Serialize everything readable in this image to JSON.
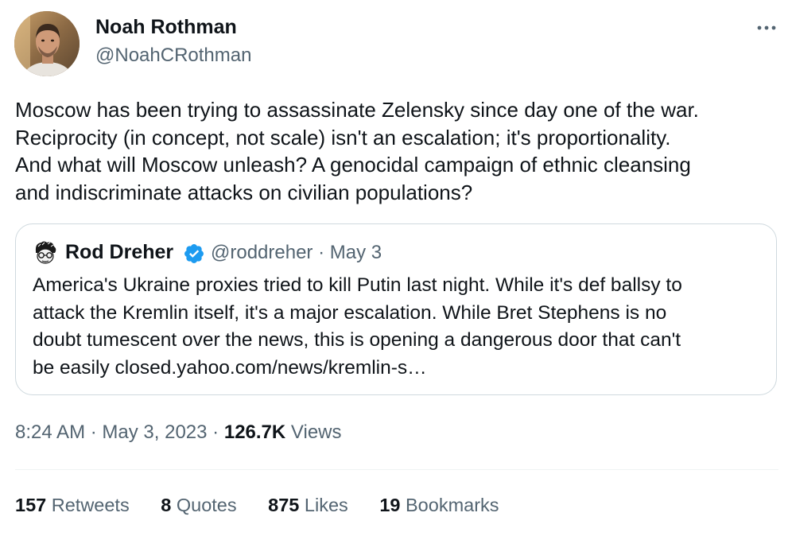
{
  "author": {
    "name": "Noah Rothman",
    "handle": "@NoahCRothman"
  },
  "tweet": {
    "text_lines": [
      "Moscow has been trying to assassinate Zelensky since day one of the war.",
      "Reciprocity (in concept, not scale) isn't an escalation; it's proportionality.",
      "And what will Moscow unleash? A genocidal campaign of ethnic cleansing",
      "and indiscriminate attacks on civilian populations?"
    ]
  },
  "quote": {
    "name": "Rod Dreher",
    "handle": "@roddreher",
    "separator": "·",
    "date": "May 3",
    "verified_icon": "verified-badge-icon",
    "text_lines": [
      "America's Ukraine proxies tried to kill Putin last night. While it's def ballsy to",
      "attack the Kremlin itself, it's a major escalation. While Bret Stephens is no",
      "doubt tumescent over the news, this is opening a dangerous door that can't",
      "be easily closed.yahoo.com/news/kremlin-s…"
    ]
  },
  "meta": {
    "time": "8:24 AM",
    "separator": "·",
    "date": "May 3, 2023",
    "views_count": "126.7K",
    "views_label": "Views"
  },
  "stats": {
    "retweets_count": "157",
    "retweets_label": "Retweets",
    "quotes_count": "8",
    "quotes_label": "Quotes",
    "likes_count": "875",
    "likes_label": "Likes",
    "bookmarks_count": "19",
    "bookmarks_label": "Bookmarks"
  },
  "icons": {
    "more": "more-options-icon"
  },
  "colors": {
    "primary_text": "#0f1419",
    "secondary_text": "#536471",
    "border": "#cfd9de",
    "verified_blue": "#1d9bf0"
  }
}
